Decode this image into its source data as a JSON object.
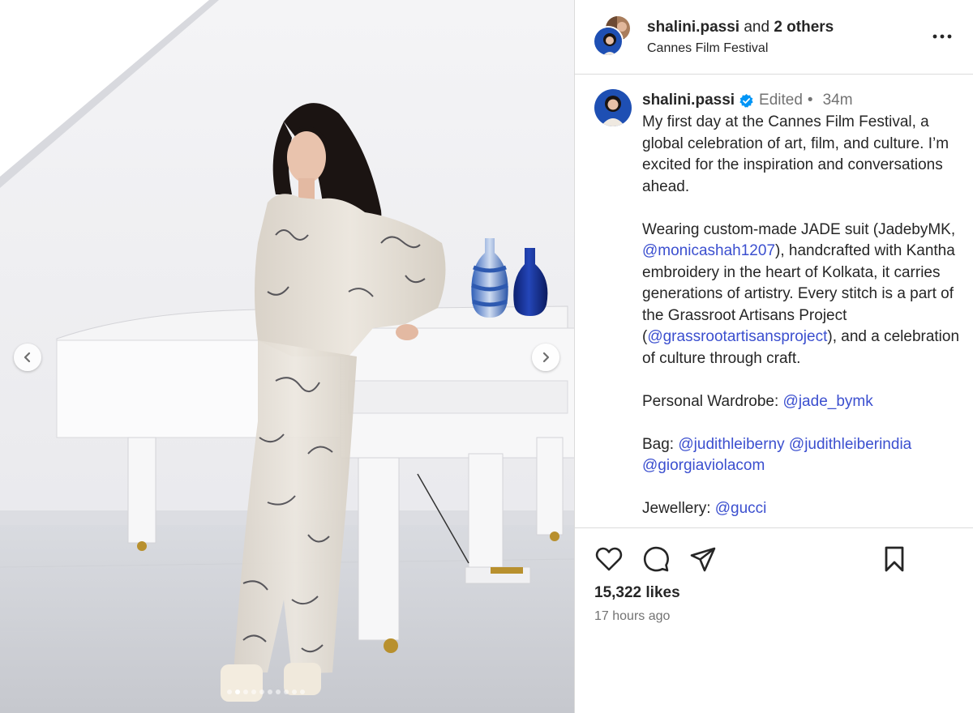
{
  "post": {
    "header": {
      "username": "shalini.passi",
      "connector": "and",
      "others": "2 others",
      "location": "Cannes Film Festival"
    },
    "caption": {
      "username": "shalini.passi",
      "edited": "Edited",
      "separator": "•",
      "age": "34m",
      "p1": "My first day at the Cannes Film Festival, a global celebration of art, film, and culture. I’m excited for the inspiration and conversations ahead.",
      "p2_a": "Wearing custom-made JADE suit (JadebyMK, ",
      "p2_m1": "@monicashah1207",
      "p2_b": "), handcrafted with Kantha embroidery in the heart of Kolkata, it carries generations of artistry. Every stitch is a part of the Grassroot Artisans Project (",
      "p2_m2": "@grassrootartisansproject",
      "p2_c": "), and a celebration of culture through craft.",
      "p3_label": "Personal Wardrobe: ",
      "p3_m": "@jade_bymk",
      "p4_label": "Bag: ",
      "p4_m1": "@judithleiberny",
      "p4_m2": "@judithleiberindia",
      "p4_m3": "@giorgiaviolacom",
      "p5_label": "Jewellery: ",
      "p5_m": "@gucci"
    },
    "likes": "15,322 likes",
    "time": "17 hours ago",
    "carousel": {
      "total": 10,
      "current": 2
    }
  },
  "icons": {
    "like": "heart-icon",
    "comment": "comment-icon",
    "share": "send-icon",
    "save": "bookmark-icon",
    "more": "more-options-icon",
    "prev": "chevron-left-icon",
    "next": "chevron-right-icon",
    "verified": "verified-badge-icon"
  },
  "colors": {
    "mention": "#3b4fcf",
    "verified": "#0095f6",
    "muted": "#737373",
    "divider": "#dbdbdb"
  }
}
